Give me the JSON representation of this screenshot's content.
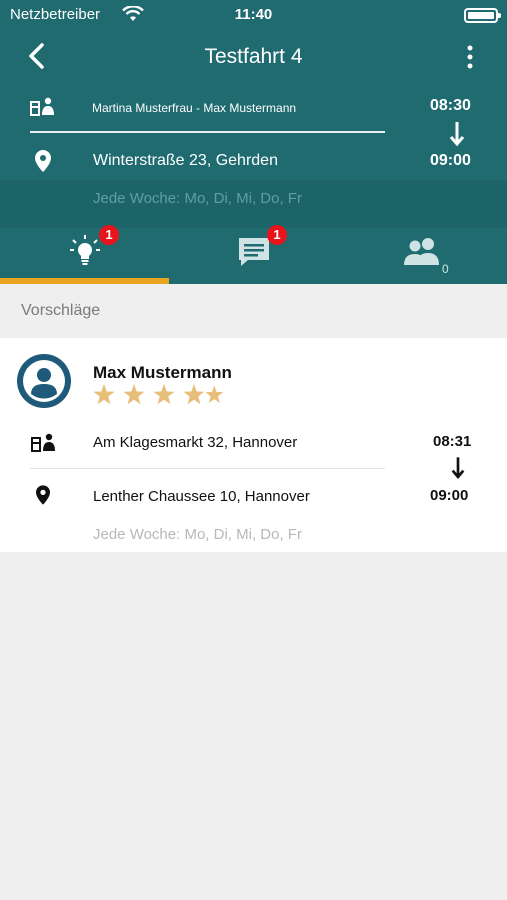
{
  "status_bar": {
    "carrier": "Netzbetreiber",
    "time": "11:40"
  },
  "nav": {
    "title": "Testfahrt 4",
    "back_icon": "chevron-left-icon",
    "more_icon": "more-vertical-icon"
  },
  "trip": {
    "participants": "Martina Musterfrau - Max Mustermann",
    "address": "Winterstraße 23, Gehrden",
    "time_start": "08:30",
    "time_end": "09:00",
    "schedule": "Jede Woche: Mo, Di, Mi, Do, Fr"
  },
  "tabs": [
    {
      "name": "ideas",
      "icon": "lightbulb-icon",
      "badge": "1",
      "active": true
    },
    {
      "name": "messages",
      "icon": "chat-icon",
      "badge": "1",
      "active": false
    },
    {
      "name": "members",
      "icon": "group-icon",
      "count": "0",
      "active": false
    }
  ],
  "section": {
    "title": "Vorschläge"
  },
  "suggestions": [
    {
      "name": "Max Mustermann",
      "rating": 5,
      "rating_max": 5,
      "from": "Am Klagesmarkt 32, Hannover",
      "to": "Lenther Chaussee 10, Hannover",
      "time_start": "08:31",
      "time_end": "09:00",
      "schedule": "Jede Woche: Mo, Di, Mi, Do, Fr"
    }
  ],
  "colors": {
    "header": "#1f6b70",
    "accent": "#e8a321",
    "badge": "#e8131b",
    "avatar": "#1f5a7a",
    "star": "#e8bf7a"
  }
}
